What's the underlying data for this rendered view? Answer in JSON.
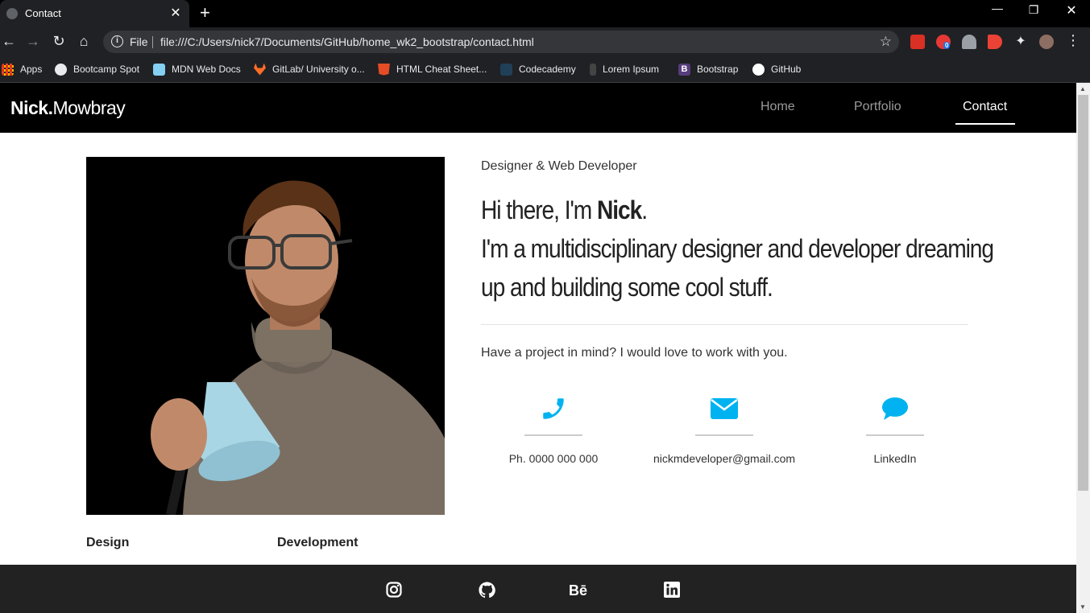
{
  "browser": {
    "tab_title": "Contact",
    "url_scheme": "File",
    "url": "file:///C:/Users/nick7/Documents/GitHub/home_wk2_bootstrap/contact.html",
    "extension_badge": "0",
    "bookmarks": [
      {
        "label": "Apps",
        "icon": "apps-grid-icon",
        "color": "#ea4335"
      },
      {
        "label": "Bootcamp Spot",
        "icon": "globe-icon",
        "color": "#e8eaed"
      },
      {
        "label": "MDN Web Docs",
        "icon": "mdn-icon",
        "color": "#83d0f2"
      },
      {
        "label": "GitLab/ University o...",
        "icon": "gitlab-icon",
        "color": "#fc6d26"
      },
      {
        "label": "HTML Cheat Sheet...",
        "icon": "html5-icon",
        "color": "#e44d26"
      },
      {
        "label": "Codecademy",
        "icon": "codecademy-icon",
        "color": "#1f4056"
      },
      {
        "label": "Lorem Ipsum",
        "icon": "lorem-icon",
        "color": "#444444"
      },
      {
        "label": "Bootstrap",
        "icon": "bootstrap-icon",
        "color": "#563d7c"
      },
      {
        "label": "GitHub",
        "icon": "github-icon",
        "color": "#ffffff"
      }
    ]
  },
  "site": {
    "brand_bold": "Nick.",
    "brand_light": "Mowbray",
    "nav": [
      {
        "label": "Home",
        "active": false
      },
      {
        "label": "Portfolio",
        "active": false
      },
      {
        "label": "Contact",
        "active": true
      }
    ],
    "subtitle": "Designer & Web Developer",
    "headline_prefix": "Hi there, I'm ",
    "headline_name": "Nick",
    "headline_suffix": ".",
    "headline_line2": "I'm a multidisciplinary designer and developer dreaming",
    "headline_line3": "up and building some cool stuff.",
    "cta": "Have a project in mind? I would love to work with you.",
    "contacts": [
      {
        "icon": "phone-icon",
        "text": "Ph. 0000 000 000"
      },
      {
        "icon": "envelope-icon",
        "text": "nickmdeveloper@gmail.com"
      },
      {
        "icon": "chat-bubble-icon",
        "text": "LinkedIn"
      }
    ],
    "skills": [
      "Design",
      "Development"
    ],
    "accent_color": "#00b3f0",
    "social": [
      "instagram-icon",
      "github-icon",
      "behance-icon",
      "linkedin-icon"
    ]
  }
}
